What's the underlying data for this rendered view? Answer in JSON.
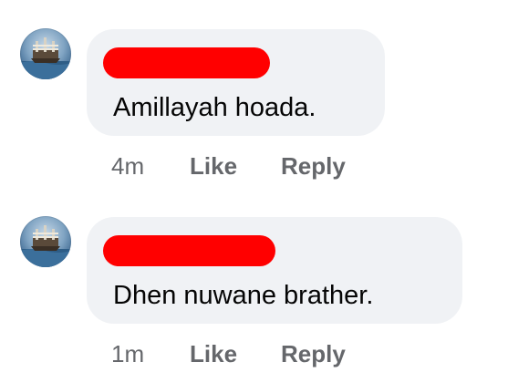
{
  "comments": [
    {
      "text": "Amillayah hoada.",
      "timestamp": "4m",
      "like_label": "Like",
      "reply_label": "Reply",
      "avatar_icon": "ship-avatar-icon"
    },
    {
      "text": "Dhen nuwane brather.",
      "timestamp": "1m",
      "like_label": "Like",
      "reply_label": "Reply",
      "avatar_icon": "ship-avatar-icon"
    }
  ],
  "colors": {
    "bubble_background": "#f0f2f5",
    "redaction": "#ff0000",
    "text_primary": "#050505",
    "text_secondary": "#65676b"
  }
}
